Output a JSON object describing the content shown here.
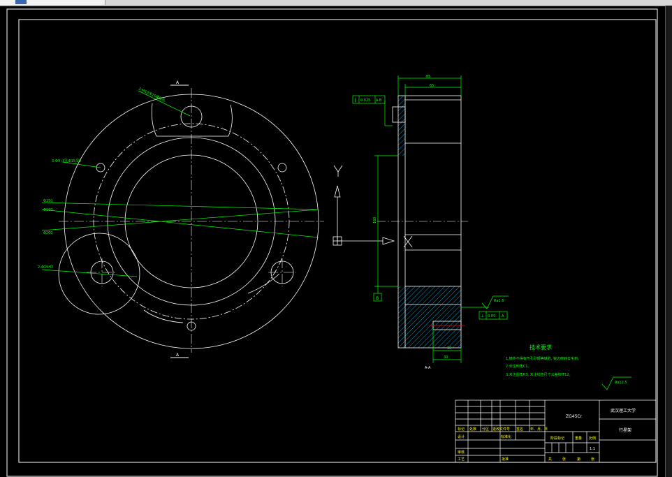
{
  "colors": {
    "white": "#ffffff",
    "green": "#00ff00",
    "cyan": "#00c8ff",
    "red": "#ff0000"
  },
  "views": {
    "section_a_label": "A",
    "section_a_label_bottom": "A",
    "section_view_label": "A-A"
  },
  "notes": {
    "callout_hole_upper": "2-M10深15螺纹孔",
    "callout_hole_left": "3-Φ9 沉孔Φ15深9",
    "callout_hole_lower_left": "2-Φ15H7",
    "dia_1": "Φ150",
    "dia_2": "Φ180",
    "dia_3": "Φ200"
  },
  "dims": {
    "top_overall": "85",
    "top_inner": "65",
    "height": "160",
    "bottom_small": "18",
    "bottom_dims": "30"
  },
  "gdt": {
    "flatness_symbol": "∥",
    "flatness_value": "0.025",
    "flatness_datum": "A-B",
    "lower_symbol": "⊥",
    "lower_value": "0.05",
    "lower_datum": "A",
    "datum_b": "B",
    "datum_a": "A"
  },
  "roughness": {
    "surface": "Ra1.6",
    "general": "Ra12.5"
  },
  "tech_req": {
    "title": "技术要求",
    "items": [
      "1.铸件不得有气孔砂眼等缺陷, 锐边倒钝去毛刺。",
      "2.未注倒角C1。",
      "3.未注圆角R3, 未注线性尺寸公差按IT12。"
    ]
  },
  "ucs": {
    "y_label": "Y",
    "x_label": "X"
  },
  "title_block": {
    "material": "ZG45Cr",
    "school": "武汉理工大学",
    "part_name": "行星架",
    "row_labels": [
      "标记",
      "处数",
      "分区",
      "更改文件号",
      "签名",
      "年、月、日"
    ],
    "designer": "设计",
    "standardize": "标准化",
    "stage_mark": "阶段标记",
    "weight": "重量",
    "scale_label": "比例",
    "scale": "1:1",
    "review": "审核",
    "process": "工艺",
    "approve": "批准",
    "sheets": [
      "共",
      "张",
      "第",
      "张"
    ]
  }
}
